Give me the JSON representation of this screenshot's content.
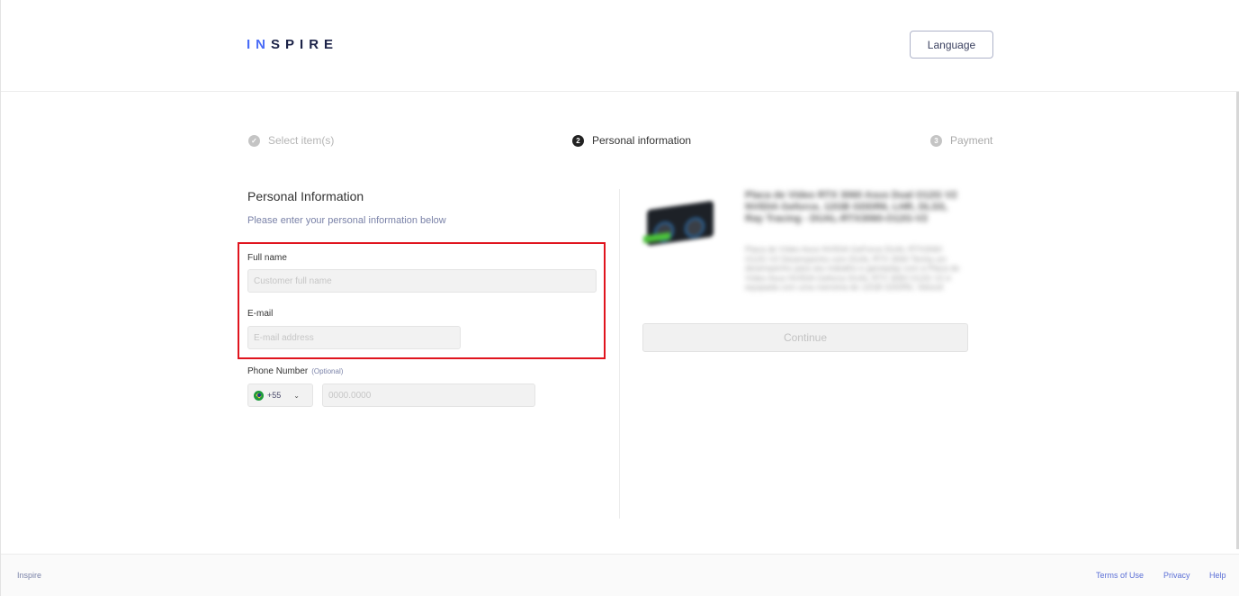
{
  "header": {
    "logo_accent": "I",
    "logo_accent_n": "N",
    "logo_rest": "SPIRE",
    "language_button": "Language"
  },
  "steps": [
    {
      "number": "✓",
      "label": "Select item(s)",
      "state": "done"
    },
    {
      "number": "2",
      "label": "Personal information",
      "state": "active"
    },
    {
      "number": "3",
      "label": "Payment",
      "state": "pending"
    }
  ],
  "form": {
    "title": "Personal Information",
    "subtitle": "Please enter your personal information below",
    "full_name": {
      "label": "Full name",
      "value": "",
      "placeholder": "Customer full name"
    },
    "email": {
      "label": "E-mail",
      "value": "",
      "placeholder": "E-mail address"
    },
    "phone": {
      "label": "Phone Number",
      "optional_label": "(Optional)",
      "country_code": "+55",
      "value": "",
      "placeholder": "0000.0000"
    }
  },
  "product": {
    "title": "Placa de Vídeo RTX 3060 Asus Dual O12G V2 NVIDIA Geforce, 12GB GDDR6, LHR, DLSS, Ray Tracing - DUAL-RTX3060-O12G-V2",
    "description": "Placa de Vídeo Asus NVIDIA GeForce DUAL RTX3060 O12G V2 Desempenho com DUAL RTX 3060 Tenha um desempenho para seu trabalho e gameplay com a Placa de Vídeo Asus NVIDIA Geforce DUAL RTX 3060 O12G V2 é equipada com uma memória de 12GB GDDR6, Velocid",
    "continue_button": "Continue"
  },
  "footer": {
    "brand": "Inspire",
    "links": [
      "Terms of Use",
      "Privacy",
      "Help"
    ]
  },
  "colors": {
    "accent": "#4a6cf7",
    "logo": "#1b2247",
    "highlight": "#e0141e",
    "link": "#5b6fd6"
  }
}
